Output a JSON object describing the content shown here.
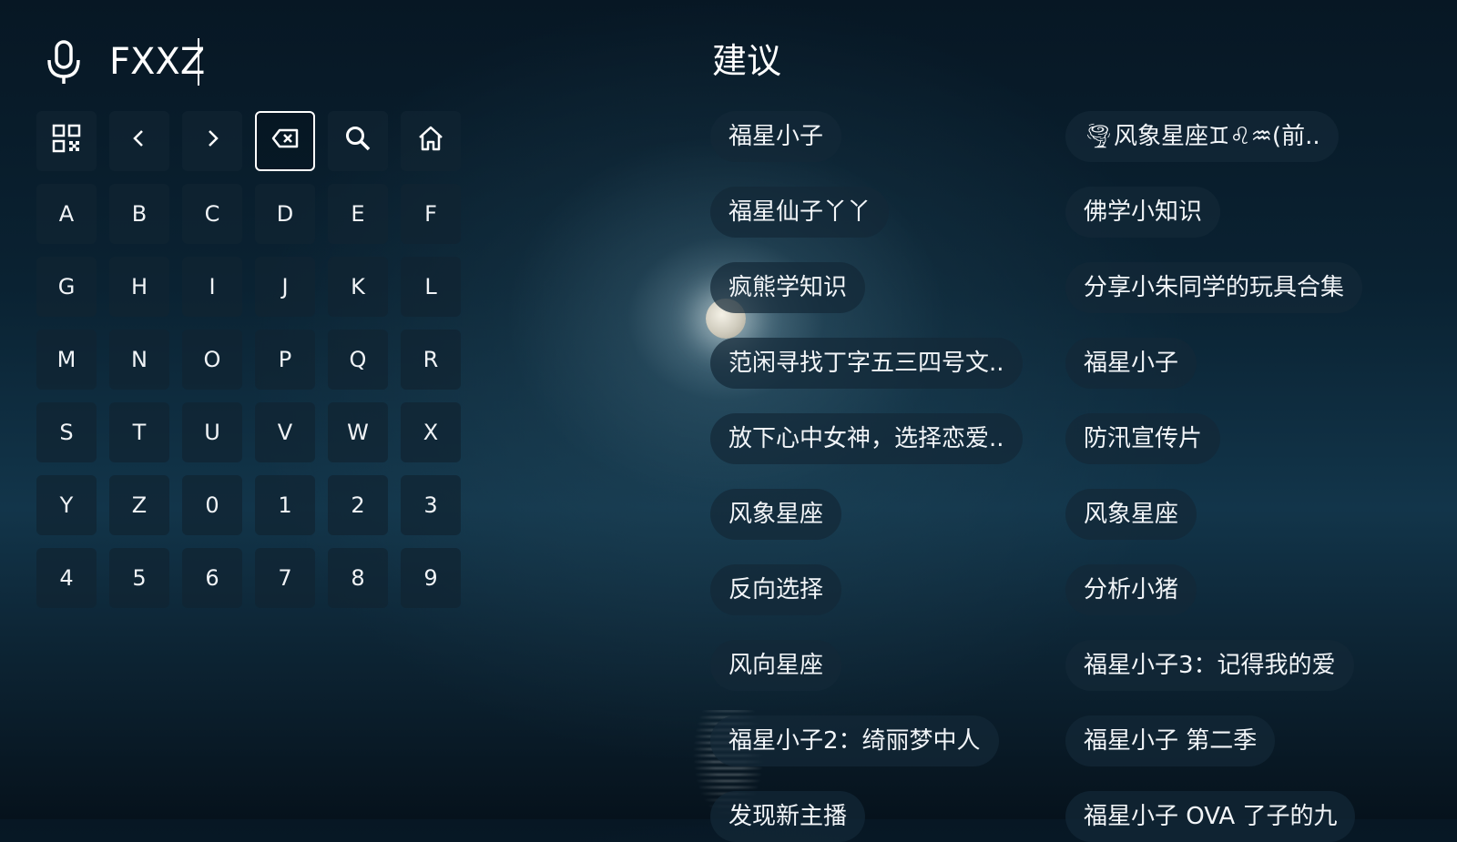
{
  "search": {
    "query": "FXXZ"
  },
  "keyboard": {
    "tools": [
      {
        "name": "qr-code-icon"
      },
      {
        "name": "cursor-left-icon"
      },
      {
        "name": "cursor-right-icon"
      },
      {
        "name": "backspace-icon"
      },
      {
        "name": "search-icon"
      },
      {
        "name": "home-icon"
      }
    ],
    "keys": [
      "A",
      "B",
      "C",
      "D",
      "E",
      "F",
      "G",
      "H",
      "I",
      "J",
      "K",
      "L",
      "M",
      "N",
      "O",
      "P",
      "Q",
      "R",
      "S",
      "T",
      "U",
      "V",
      "W",
      "X",
      "Y",
      "Z",
      "0",
      "1",
      "2",
      "3",
      "4",
      "5",
      "6",
      "7",
      "8",
      "9"
    ]
  },
  "suggestions": {
    "heading": "建议",
    "left": [
      "福星小子",
      "福星仙子丫丫",
      "疯熊学知识",
      "范闲寻找丁字五三四号文..",
      "放下心中女神，选择恋爱..",
      "风象星座",
      "反向选择",
      "风向星座",
      "福星小子2：绮丽梦中人",
      "发现新主播"
    ],
    "right": [
      "🌪风象星座♊♌♒(前..",
      "佛学小知识",
      "分享小朱同学的玩具合集",
      "福星小子",
      "防汛宣传片",
      "风象星座",
      "分析小猪",
      "福星小子3：记得我的爱",
      "福星小子 第二季",
      "福星小子 OVA 了子的九"
    ]
  }
}
